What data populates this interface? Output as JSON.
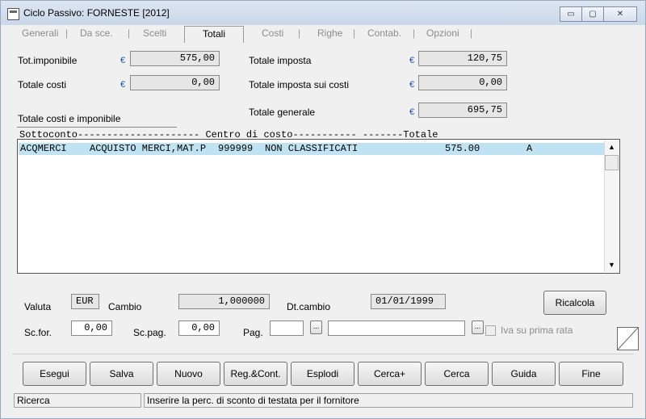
{
  "window": {
    "title": "Ciclo Passivo: FORNESTE   [2012]",
    "controls": {
      "minimize": "▭",
      "maximize": "▢",
      "close": "✕"
    }
  },
  "tabs": [
    "Generali",
    "Da sce.",
    "Scelti",
    "Totali",
    "Costi",
    "Righe",
    "Contab.",
    "Opzioni"
  ],
  "totals": {
    "tot_imponibile": {
      "label": "Tot.imponibile",
      "value": "575,00"
    },
    "totale_costi": {
      "label": "Totale costi",
      "value": "0,00"
    },
    "totale_costi_imponibile": {
      "label": "Totale costi e imponibile"
    },
    "totale_imposta": {
      "label": "Totale imposta",
      "value": "120,75"
    },
    "totale_imposta_costi": {
      "label": "Totale imposta sui costi",
      "value": "0,00"
    },
    "totale_generale": {
      "label": "Totale generale",
      "value": "695,75"
    },
    "currency_symbol": "€"
  },
  "list": {
    "header": "Sottoconto--------------------- Centro di costo----------- -------Totale",
    "rows": [
      {
        "code": "ACQMERCI",
        "description": "ACQUISTO MERCI,MAT.P",
        "cost_center_code": "999999",
        "cost_center": "NON CLASSIFICATI",
        "total": "575.00",
        "flag": "A"
      }
    ]
  },
  "currency": {
    "valuta_label": "Valuta",
    "valuta_value": "EUR",
    "cambio_label": "Cambio",
    "cambio_value": "1,000000",
    "dtcambio_label": "Dt.cambio",
    "dtcambio_value": "01/01/1999",
    "ricalcola_label": "Ricalcola"
  },
  "discounts": {
    "scfor_label": "Sc.for.",
    "scfor_value": "0,00",
    "scpag_label": "Sc.pag.",
    "scpag_value": "0,00",
    "pag_label": "Pag.",
    "pag_code": "",
    "pag_desc": "",
    "lookup_label": "...",
    "iva_label": "Iva su prima rata"
  },
  "buttons": [
    "Esegui",
    "Salva",
    "Nuovo",
    "Reg.&Cont.",
    "Esplodi",
    "Cerca+",
    "Cerca",
    "Guida",
    "Fine"
  ],
  "status": {
    "left": "Ricerca",
    "right": "Inserire la perc. di sconto di testata per il fornitore"
  },
  "colors": {
    "selected_row": "#bfe3f3",
    "euro": "#1a4fb5"
  }
}
